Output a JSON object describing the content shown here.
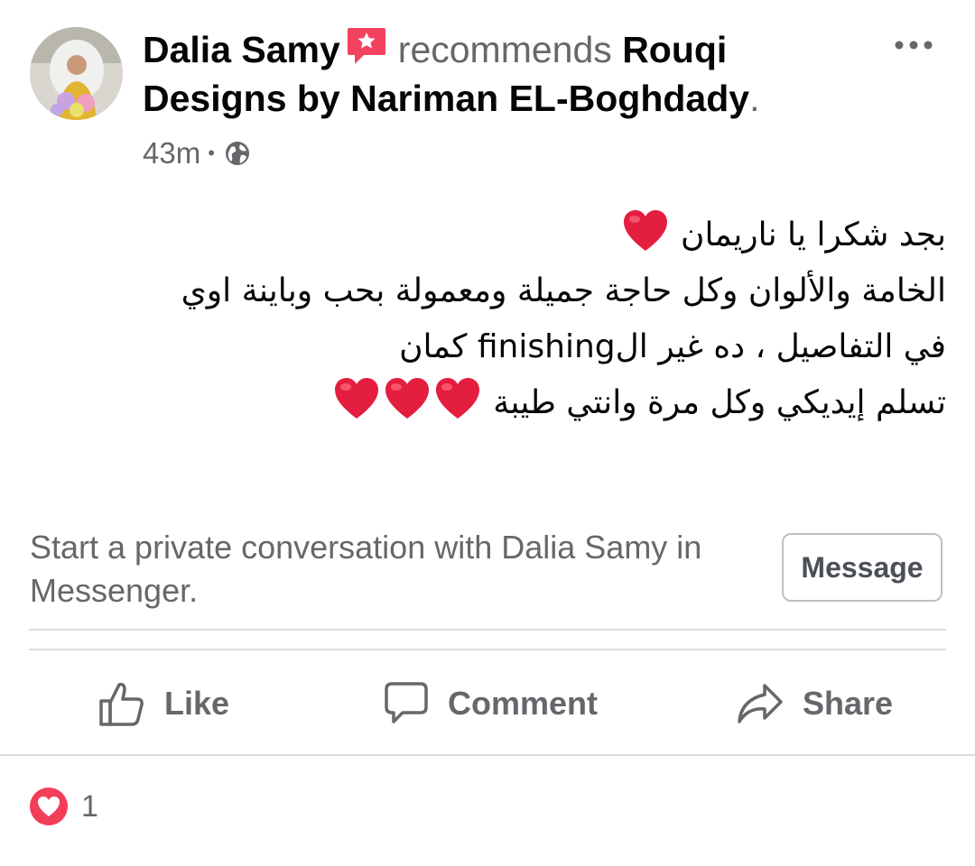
{
  "post": {
    "author": "Dalia Samy",
    "verb": "recommends",
    "page_name": "Rouqi Designs by Nariman EL-Boghdady",
    "period": ".",
    "time": "43m",
    "separator": "•",
    "privacy_icon": "globe-icon",
    "badge_icon": "recommendation-badge-icon",
    "more_icon": "more-options-icon",
    "body_lines": [
      {
        "text": "بجد شكرا يا ناريمان",
        "hearts": 1
      },
      {
        "text": "الخامة والألوان وكل حاجة جميلة ومعمولة بحب وباينة اوي",
        "hearts": 0
      },
      {
        "text": "في التفاصيل ، ده غير الfinishing كمان",
        "hearts": 0
      },
      {
        "text": "تسلم إيديكي وكل مرة وانتي طيبة",
        "hearts": 3
      }
    ],
    "body_emoji": "red-heart-emoji"
  },
  "messenger_prompt": {
    "text": "Start a private conversation with Dalia Samy in Messenger.",
    "button_label": "Message"
  },
  "actions": {
    "like": {
      "label": "Like",
      "icon": "like-thumb-icon"
    },
    "comment": {
      "label": "Comment",
      "icon": "comment-bubble-icon"
    },
    "share": {
      "label": "Share",
      "icon": "share-arrow-icon"
    }
  },
  "reactions": {
    "icon": "love-reaction-icon",
    "count": "1"
  },
  "colors": {
    "text_primary": "#050505",
    "text_secondary": "#65676b",
    "badge": "#f3425f",
    "heart": "#e41e3f",
    "love_reaction": "#f33e58",
    "divider": "#dadde1",
    "button_border": "#bcc0c4"
  }
}
